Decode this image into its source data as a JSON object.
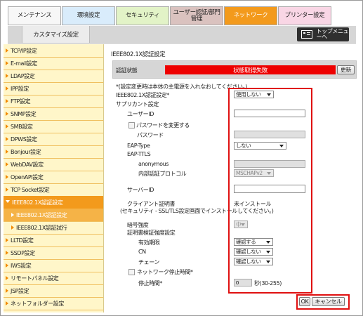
{
  "tabs": [
    {
      "label": "メンテナンス",
      "bg": "#f7f7f7"
    },
    {
      "label": "環境設定",
      "bg": "#d9ecfb"
    },
    {
      "label": "セキュリティ",
      "bg": "#e2f3c7"
    },
    {
      "label": "ユーザー認証/部門管理",
      "bg": "#dac2bf"
    },
    {
      "label": "ネットワーク",
      "bg": "#f39a1c"
    },
    {
      "label": "プリンター設定",
      "bg": "#f9d6e5"
    }
  ],
  "subtab_label": "カスタマイズ設定",
  "top_menu_label": "トップメニューへ",
  "sidebar": [
    {
      "label": "TCP/IP設定"
    },
    {
      "label": "E-mail設定"
    },
    {
      "label": "LDAP設定"
    },
    {
      "label": "IPP設定"
    },
    {
      "label": "FTP設定"
    },
    {
      "label": "SNMP設定"
    },
    {
      "label": "SMB設定"
    },
    {
      "label": "DPWS設定"
    },
    {
      "label": "Bonjour設定"
    },
    {
      "label": "WebDAV設定"
    },
    {
      "label": "OpenAPI設定"
    },
    {
      "label": "TCP Socket設定"
    },
    {
      "label": "IEEE802.1X認証設定"
    },
    {
      "label": "IEEE802.1X認証設定"
    },
    {
      "label": "IEEE802.1X認証試行"
    },
    {
      "label": "LLTD設定"
    },
    {
      "label": "SSDP設定"
    },
    {
      "label": "IWS設定"
    },
    {
      "label": "リモートパネル設定"
    },
    {
      "label": "JSP設定"
    },
    {
      "label": "ネットフォルダー設定"
    }
  ],
  "main": {
    "title": "IEEE802.1X認証設定",
    "status_label": "認証状態",
    "status_value": "状態取得失敗",
    "refresh_label": "更新",
    "note": "*(設定変更時は本体の主電源を入れなおしてください。)",
    "ieee_label": "IEEE802.1X認証設定*",
    "ieee_value": "使用しない",
    "supplicant_label": "サプリカント設定",
    "user_id_label": "ユーザーID",
    "user_id_value": "",
    "change_password_label": "パスワードを変更する",
    "password_label": "パスワード",
    "eap_type_label": "EAP-Type",
    "eap_type_value": "しない",
    "eap_ttls_label": "EAP-TTLS",
    "anonymous_label": "anonymous",
    "inner_protocol_label": "内部認証プロトコル",
    "inner_protocol_value": "MSCHAPv2",
    "server_id_label": "サーバーID",
    "server_id_value": "",
    "client_cert_label": "クライアント証明書",
    "client_cert_value": "未インストール",
    "client_cert_note": "(セキュリティ - SSL/TLS設定画面でインストールしてください。)",
    "encryption_label": "暗号強度",
    "encryption_value": "中",
    "cert_verify_label": "証明書検証強度設定",
    "validity_label": "有効期限",
    "validity_value": "確認する",
    "cn_label": "CN",
    "cn_value": "確認しない",
    "chain_label": "チェーン",
    "chain_value": "確認しない",
    "network_stop_label": "ネットワーク停止時間*",
    "stop_time_label": "停止時間*",
    "stop_time_value": "0",
    "stop_time_unit": "秒(30-255)",
    "ok_label": "OK",
    "cancel_label": "キャンセル"
  },
  "colors": {
    "accent": "#f39a1c",
    "highlight": "#e01010",
    "status_error": "#ee0000"
  }
}
